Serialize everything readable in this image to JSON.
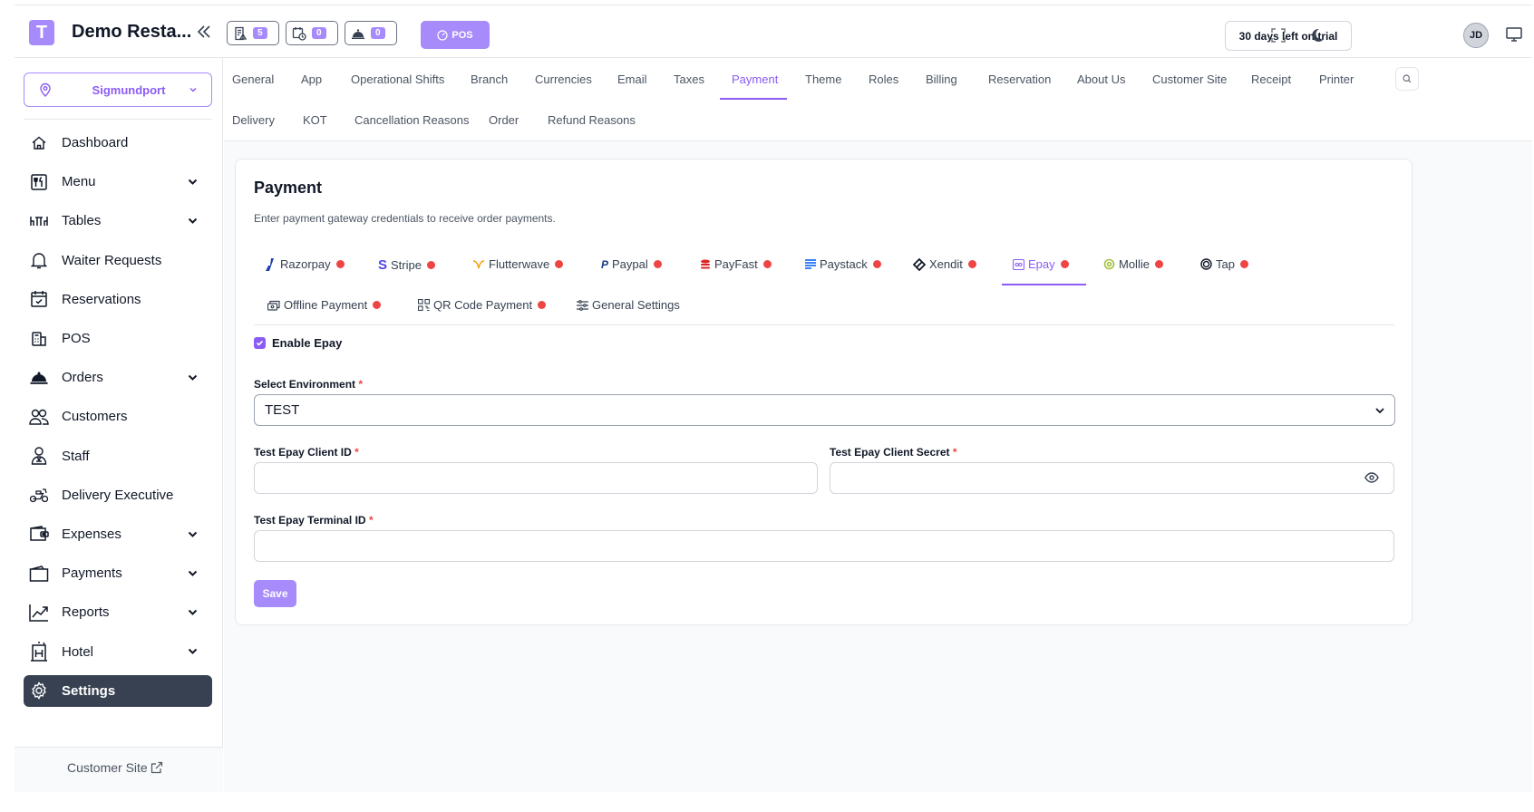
{
  "app": {
    "logo_letter": "T",
    "title": "Demo Resta..."
  },
  "topbar": {
    "counters": [
      {
        "icon": "receipt-icon",
        "count": "5"
      },
      {
        "icon": "calendar-clock-icon",
        "count": "0"
      },
      {
        "icon": "bell-service-icon",
        "count": "0"
      }
    ],
    "pos_label": "POS",
    "trial_label": "30 days left on trial",
    "avatar_initials": "JD"
  },
  "sidebar": {
    "branch": "Sigmundport",
    "items": [
      {
        "label": "Dashboard",
        "icon": "home-icon",
        "has_children": false
      },
      {
        "label": "Menu",
        "icon": "menu-book-icon",
        "has_children": true
      },
      {
        "label": "Tables",
        "icon": "table-icon",
        "has_children": true
      },
      {
        "label": "Waiter Requests",
        "icon": "bell-icon",
        "has_children": false
      },
      {
        "label": "Reservations",
        "icon": "calendar-check-icon",
        "has_children": false
      },
      {
        "label": "POS",
        "icon": "pos-terminal-icon",
        "has_children": false
      },
      {
        "label": "Orders",
        "icon": "cloche-icon",
        "has_children": true
      },
      {
        "label": "Customers",
        "icon": "users-icon",
        "has_children": false
      },
      {
        "label": "Staff",
        "icon": "staff-icon",
        "has_children": false
      },
      {
        "label": "Delivery Executive",
        "icon": "scooter-icon",
        "has_children": false
      },
      {
        "label": "Expenses",
        "icon": "wallet-icon",
        "has_children": true
      },
      {
        "label": "Payments",
        "icon": "wallet-outline-icon",
        "has_children": true
      },
      {
        "label": "Reports",
        "icon": "chart-line-icon",
        "has_children": true
      },
      {
        "label": "Hotel",
        "icon": "hotel-icon",
        "has_children": true
      },
      {
        "label": "Settings",
        "icon": "gear-icon",
        "has_children": false,
        "active": true
      }
    ],
    "footer_link": "Customer Site"
  },
  "settings_tabs": {
    "row1": [
      "General",
      "App",
      "Operational Shifts",
      "Branch",
      "Currencies",
      "Email",
      "Taxes",
      "Payment",
      "Theme",
      "Roles",
      "Billing",
      "Reservation",
      "About Us",
      "Customer Site",
      "Receipt",
      "Printer"
    ],
    "row2": [
      "Delivery",
      "KOT",
      "Cancellation Reasons",
      "Order",
      "Refund Reasons"
    ],
    "active": "Payment"
  },
  "payment": {
    "title": "Payment",
    "subtitle": "Enter payment gateway credentials to receive order payments.",
    "gateways_row1": [
      "Razorpay",
      "Stripe",
      "Flutterwave",
      "Paypal",
      "PayFast",
      "Paystack",
      "Xendit",
      "Epay",
      "Mollie",
      "Tap"
    ],
    "gateways_row2": [
      "Offline Payment",
      "QR Code Payment",
      "General Settings"
    ],
    "active_gateway": "Epay",
    "enable_label": "Enable Epay",
    "enable_checked": true,
    "environment_label": "Select Environment",
    "environment_value": "TEST",
    "client_id_label": "Test Epay Client ID",
    "client_id_value": "",
    "client_secret_label": "Test Epay Client Secret",
    "client_secret_value": "",
    "terminal_id_label": "Test Epay Terminal ID",
    "terminal_id_value": "",
    "required_mark": "*",
    "save_label": "Save"
  },
  "colors": {
    "accent": "#a78bfa",
    "accent_text": "#8b5cf6",
    "status_dot": "#ef4444",
    "active_nav": "#374151"
  }
}
